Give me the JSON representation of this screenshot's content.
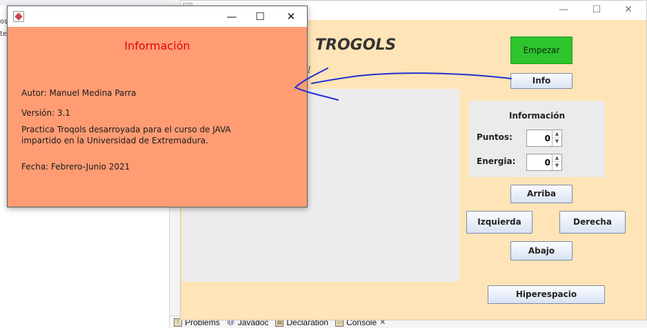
{
  "ide": {
    "left_fragments": [
      "os",
      "ter"
    ],
    "bottom_tabs": [
      {
        "label": "Problems",
        "icon": "problems-icon"
      },
      {
        "label": "Javadoc",
        "icon": "at-icon"
      },
      {
        "label": "Declaration",
        "icon": "declaration-icon"
      },
      {
        "label": "Console",
        "icon": "console-icon"
      }
    ],
    "close_glyph": "✕"
  },
  "main_window": {
    "title": "TROGOLS",
    "author_fragment": "uel",
    "controls": {
      "minimize": "—",
      "maximize": "☐",
      "close": "✕"
    },
    "buttons": {
      "start": "Empezar",
      "info": "Info",
      "up": "Arriba",
      "left": "Izquierda",
      "right": "Derecha",
      "down": "Abajo",
      "hyperspace": "Hiperespacio"
    },
    "info_panel": {
      "title": "Información",
      "points_label": "Puntos:",
      "points_value": "0",
      "energy_label": "Energia:",
      "energy_value": "0"
    },
    "colors": {
      "background": "#ffe4b7",
      "start_button": "#2ec42e",
      "board": "#ececec"
    }
  },
  "dialog": {
    "heading": "Información",
    "controls": {
      "minimize": "—",
      "maximize": "☐",
      "close": "✕"
    },
    "author": "Autor:  Manuel Medina Parra",
    "version": "Versión: 3.1",
    "description_line1": "Practica Troqols desarroyada para el curso de JAVA",
    "description_line2": "impartido en la Universidad de Extremadura.",
    "date": "Fecha: Febrero-Junio 2021",
    "colors": {
      "background": "#ff9c74",
      "heading": "#e4000e"
    }
  },
  "annotation": {
    "color": "#1d2fd6",
    "icon": "hand-drawn-arrow-icon"
  }
}
